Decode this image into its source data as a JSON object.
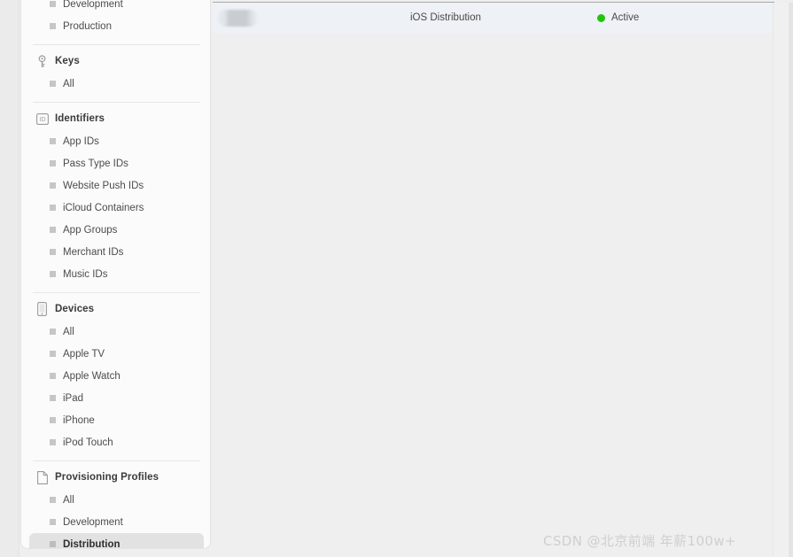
{
  "sidebar": {
    "groups": [
      {
        "id": "certificates-partial",
        "title": "",
        "icon": "",
        "show_header": false,
        "show_divider_before": false,
        "items": [
          {
            "label": "Development",
            "selected": false
          },
          {
            "label": "Production",
            "selected": false
          }
        ]
      },
      {
        "id": "keys",
        "title": "Keys",
        "icon": "key-icon",
        "show_header": true,
        "show_divider_before": true,
        "items": [
          {
            "label": "All",
            "selected": false
          }
        ]
      },
      {
        "id": "identifiers",
        "title": "Identifiers",
        "icon": "id-badge-icon",
        "show_header": true,
        "show_divider_before": true,
        "items": [
          {
            "label": "App IDs",
            "selected": false
          },
          {
            "label": "Pass Type IDs",
            "selected": false
          },
          {
            "label": "Website Push IDs",
            "selected": false
          },
          {
            "label": "iCloud Containers",
            "selected": false
          },
          {
            "label": "App Groups",
            "selected": false
          },
          {
            "label": "Merchant IDs",
            "selected": false
          },
          {
            "label": "Music IDs",
            "selected": false
          }
        ]
      },
      {
        "id": "devices",
        "title": "Devices",
        "icon": "iphone-icon",
        "show_header": true,
        "show_divider_before": true,
        "items": [
          {
            "label": "All",
            "selected": false
          },
          {
            "label": "Apple TV",
            "selected": false
          },
          {
            "label": "Apple Watch",
            "selected": false
          },
          {
            "label": "iPad",
            "selected": false
          },
          {
            "label": "iPhone",
            "selected": false
          },
          {
            "label": "iPod Touch",
            "selected": false
          }
        ]
      },
      {
        "id": "provisioning-profiles",
        "title": "Provisioning Profiles",
        "icon": "document-icon",
        "show_header": true,
        "show_divider_before": true,
        "items": [
          {
            "label": "All",
            "selected": false
          },
          {
            "label": "Development",
            "selected": false
          },
          {
            "label": "Distribution",
            "selected": true
          }
        ]
      }
    ]
  },
  "main": {
    "rows": [
      {
        "name_redacted": true,
        "type": "iOS Distribution",
        "status": "Active",
        "status_color": "#21c40d"
      }
    ]
  },
  "watermark": {
    "text": "CSDN @北京前端 年薪100w+"
  }
}
